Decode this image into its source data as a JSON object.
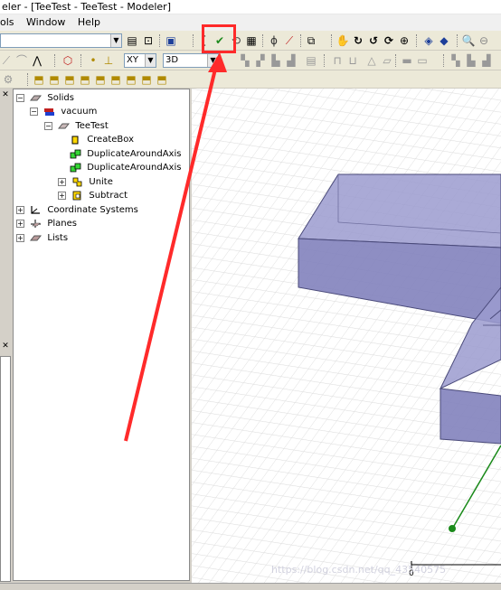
{
  "window": {
    "title": "eler - [TeeTest - TeeTest - Modeler]"
  },
  "menu": {
    "items": [
      "ols",
      "Window",
      "Help"
    ]
  },
  "toolbar": {
    "plane_select": "XY",
    "view_select": "3D"
  },
  "tree": {
    "items": [
      {
        "label": "Solids"
      },
      {
        "label": "vacuum"
      },
      {
        "label": "TeeTest"
      },
      {
        "label": "CreateBox"
      },
      {
        "label": "DuplicateAroundAxis"
      },
      {
        "label": "DuplicateAroundAxis"
      },
      {
        "label": "Unite"
      },
      {
        "label": "Subtract"
      },
      {
        "label": "Coordinate Systems"
      },
      {
        "label": "Planes"
      },
      {
        "label": "Lists"
      }
    ]
  },
  "viewport": {
    "watermark": "https://blog.csdn.net/qq_43540575",
    "scale_zero": "0"
  },
  "colors": {
    "highlight": "#ff2a2a",
    "arrow": "#ff2a2a",
    "solid_fill": "#8f8fc4",
    "axis_green": "#1a8a1a"
  }
}
